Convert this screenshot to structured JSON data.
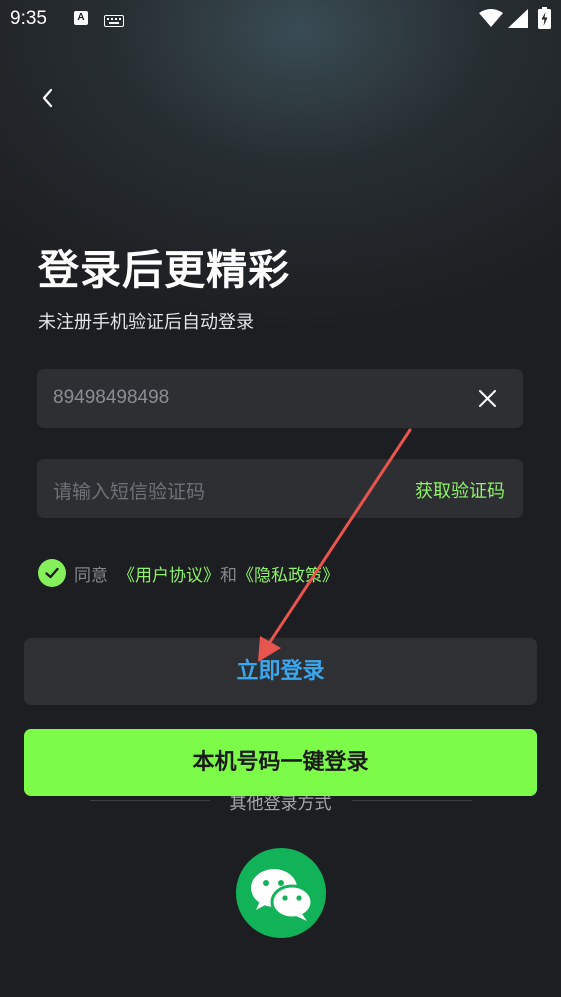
{
  "status_bar": {
    "time": "9:35",
    "input_method_badge": "A"
  },
  "header": {
    "title": "登录后更精彩",
    "subtitle": "未注册手机验证后自动登录"
  },
  "phone_field": {
    "value": "89498498498"
  },
  "code_field": {
    "placeholder": "请输入短信验证码",
    "get_code_label": "获取验证码"
  },
  "agreement": {
    "prefix": "同意",
    "user_agreement": "《用户协议》",
    "and": "和",
    "privacy_policy": "《隐私政策》",
    "checked": true
  },
  "buttons": {
    "login": "立即登录",
    "one_key_login": "本机号码一键登录"
  },
  "other_login": {
    "label": "其他登录方式",
    "methods": [
      "wechat-icon"
    ]
  },
  "colors": {
    "accent_green": "#7cfb49",
    "link_green": "#8ef26a",
    "login_text_blue": "#3aa7ee",
    "wechat_green": "#12b259",
    "annotation_red": "#e8554e"
  }
}
